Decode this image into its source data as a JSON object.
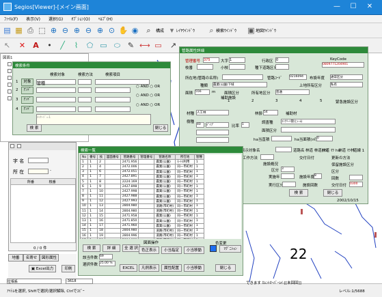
{
  "window": {
    "title": "Segios[Viewer]-[メイン画面]",
    "min": "—",
    "max": "☐",
    "close": "✕"
  },
  "menu": [
    "ﾌｧｲﾙ(F)",
    "表示(V)",
    "選択(G)",
    "ｵﾌﾟｼｮﾝ(O)",
    "ﾍﾙﾌﾟ(H)"
  ],
  "toolbar": {
    "frame_label": "構成",
    "layer_label": "ﾚｲﾔｳｲﾝﾄﾞｳ",
    "search_label": "検索ｳｲﾝﾄﾞｳ",
    "map_label": "地図ｳｲﾝﾄﾞｳ"
  },
  "tree": {
    "root": "図面1",
    "items": [
      "",
      "",
      "",
      "",
      "",
      "",
      "",
      ""
    ]
  },
  "search_dialog": {
    "title": "検索条件",
    "col_target": "検索対象",
    "col_method": "検索方法",
    "col_value": "検索項目",
    "rows": [
      {
        "no": "1",
        "kind": "対象",
        "field": "管種"
      },
      {
        "no": "2",
        "kind": "ｱﾝﾄﾞ",
        "field": ""
      },
      {
        "no": "3",
        "kind": "ｱﾝﾄﾞ",
        "field": ""
      },
      {
        "no": "4",
        "kind": "ｱﾝﾄﾞ",
        "field": ""
      }
    ],
    "and_label": "AND",
    "or_label": "OR",
    "result_text": "ﾒｯｾｰｼﾞ=1",
    "search_btn": "検 索",
    "close_btn": "閉じる"
  },
  "detail": {
    "title": "管路属性詳細",
    "kanri_label": "管理番号",
    "kanri_value": "375",
    "jiban_label": "大字",
    "jiban_value": "1",
    "chiku_label": "行政区",
    "chiku_value": "0",
    "keycode_label": "KeyCode",
    "keycode_value": "0809771204901",
    "line2_label": "枝番",
    "line2b": "小枝",
    "line2c": "種下道路区分",
    "region_label": "所在地(管路の名称)",
    "region_value": "",
    "pipe_label": "管路ｺｰﾄﾞ",
    "pipe_value": "0216094",
    "owner_label": "布設年度",
    "owner_value": "通常区分",
    "line_label": "種類",
    "line_value": "農業(公園)下域",
    "water_label": "上地所有区分",
    "water_value": "私有",
    "ocean_label": "面積",
    "ocean_value": "556",
    "unit": "m",
    "area_label": "面積区分",
    "area2_label": "所有地区分",
    "area2_value": "普通",
    "field1": "1",
    "field2": "2",
    "field3": "3",
    "field4": "4",
    "field5": "5",
    "sub_label": "補助施設",
    "sub2": "緊急施設区分",
    "mat_label": "材種",
    "mat_value": "人工林",
    "flow_label": "林齢",
    "flow_value": "54",
    "fl_label": "補助材",
    "cls_label": "樹種",
    "cls1": "40",
    "cls1b": "ﾊﾟｲﾌﾟ",
    "ratio_label": "比率",
    "ratio_value": "1",
    "shape_label": "調査種",
    "shape_value": "ｺﾝｸﾘｰﾄ管(ﾋｭｰﾑ)",
    "area3": "面積区分",
    "ha_label": "ha当直積",
    "ha_label2": "ha当面積(㎡)",
    "ha_value": "0",
    "bottom": [
      "表示対象名",
      "道路名",
      "林道 林道(ﾏﾂ)",
      "林道 ﾏﾂ ha",
      "林道 ﾏﾂ林",
      "道線 1"
    ],
    "side_labels": [
      "工作方法",
      "施設概況",
      "区分",
      "実施年",
      "施設年度",
      "交付日付"
    ],
    "side_labels2": [
      "更新の方法",
      "保留施設区分",
      "区分",
      "回数",
      "交付日付"
    ],
    "side_values": [
      "",
      "",
      "3",
      "",
      "8",
      "0300"
    ],
    "exec_label": "実行区分",
    "exec2": "施設回数",
    "exec3": "施設分類",
    "exec4": "補強等",
    "exec5": "実施日",
    "exec6": "07/",
    "exec7": "2024",
    "search_btn": "検 索",
    "close_btn": "閉じる",
    "date": "2002/10/15"
  },
  "list_window": {
    "title": "検索一覧",
    "headers": [
      "No",
      "番号",
      "枝",
      "図面番号",
      "管路番号",
      "管理番号",
      "管路名称",
      "所在地",
      "管種"
    ],
    "rows": [
      [
        "1",
        "1",
        "2",
        "",
        "2471.956",
        "",
        "農業(公園)",
        "ﾓｰﾄﾙ利用",
        "1"
      ],
      [
        "2",
        "1",
        "4",
        "",
        "2472.006",
        "",
        "農業(公園)",
        "同一市町村",
        "1"
      ],
      [
        "3",
        "1",
        "6",
        "",
        "2472.051",
        "",
        "農業(公園)",
        "同一市町村",
        "1"
      ],
      [
        "4",
        "1",
        "7",
        "",
        "2427.891",
        "",
        "農業(公園)",
        "同一市町村",
        "1"
      ],
      [
        "5",
        "1",
        "8",
        "",
        "2224.169",
        "",
        "農業(公園)",
        "同一市町村",
        "1"
      ],
      [
        "6",
        "1",
        "9",
        "",
        "2427.898",
        "",
        "農業(公園)",
        "同一市町村",
        "1"
      ],
      [
        "7",
        "1",
        "10",
        "",
        "2427.998",
        "",
        "農業(公園)",
        "同一市町村",
        "1"
      ],
      [
        "8",
        "1",
        "11",
        "",
        "2427.988",
        "",
        "農業(公園)",
        "同一市町村",
        "1"
      ],
      [
        "9",
        "1",
        "12",
        "",
        "2427.993",
        "",
        "農業(公園)",
        "同一市町村",
        "1"
      ],
      [
        "10",
        "1",
        "13",
        "",
        "2804.980",
        "",
        "道路(市町村)",
        "同一市町村",
        "1"
      ],
      [
        "11",
        "1",
        "14",
        "",
        "2804.980",
        "",
        "道路(市町村)",
        "同一市町村",
        "1"
      ],
      [
        "12",
        "1",
        "15",
        "",
        "2471.958",
        "",
        "農業(公園)",
        "同一市町村",
        "1"
      ],
      [
        "13",
        "1",
        "16",
        "",
        "2471.850",
        "",
        "農業(公園)",
        "同一市町村",
        "1"
      ],
      [
        "14",
        "1",
        "17",
        "",
        "2471.960",
        "",
        "農業(公園)",
        "同一市町村",
        "1"
      ],
      [
        "15",
        "1",
        "18",
        "",
        "2804.980",
        "",
        "道路(市町村)",
        "同一市町村",
        "1"
      ],
      [
        "16",
        "1",
        "19",
        "",
        "2804.996",
        "",
        "道路(市町村)",
        "同一市町村",
        "1"
      ],
      [
        "17",
        "1",
        "20",
        "",
        "2804.980",
        "",
        "道路(市町村)",
        "同一市町村",
        "1"
      ],
      [
        "18",
        "1",
        "21",
        "",
        "2804.966",
        "",
        "道路(市町村)",
        "同一市町村",
        "1"
      ],
      [
        "19",
        "1",
        "22",
        "",
        "2804.966",
        "",
        "道路(市町村)",
        "同一市町村",
        "1"
      ],
      [
        "20",
        "1",
        "23",
        "",
        "2804.980",
        "",
        "道路(市町村)",
        "同一市町村",
        "1"
      ],
      [
        "21",
        "1",
        "24",
        "",
        "2804.980",
        "",
        "道路(市町村)",
        "同一市町村",
        "1"
      ],
      [
        "22",
        "1",
        "25",
        "",
        "2804.958",
        "",
        "道路(市町村)",
        "同一市町村",
        "1"
      ],
      [
        "23",
        "1",
        "26",
        "",
        "2804.958",
        "",
        "道路(市町村)",
        "同一市町村",
        "1"
      ],
      [
        "24",
        "1",
        "27",
        "",
        "2804.958",
        "",
        "道路(市町村)",
        "同一市町村",
        "1"
      ],
      [
        "25",
        "1",
        "28",
        "",
        "2804.958",
        "",
        "道路(市町村)",
        "同一市町村",
        "1"
      ],
      [
        "26",
        "1",
        "29",
        "",
        "2804.958",
        "",
        "道路(市町村)",
        "同一市町村",
        "1"
      ]
    ],
    "btn_search": "検 索",
    "btn_detail": "詳 細",
    "btn_close": "全 選 択",
    "btn_nodisp": "全 選 択",
    "count_label": "該当件数",
    "count_value": "69",
    "cur_label": "選択件数",
    "cur_value": "25.00 %",
    "panel_title": "図面操作",
    "p1": "色正表示",
    "p2": "小当指定",
    "p3": "小当移動",
    "p4": "EXCEL",
    "p5": "凡例表示",
    "p6": "属性配置",
    "p7": "小当移動",
    "color_label": "色変更",
    "color_btn": "ﾏｸﾞﾆｼｮﾝ",
    "close2": "閉じる"
  },
  "left_panel": {
    "pref_label": "字 名",
    "area_label": "所 在",
    "hyphen": "-",
    "h1": "所番",
    "h2": "枝番",
    "count": "0 / 0 件",
    "tab1": "地番",
    "tab2": "名寄せ",
    "tab3": "図形属性",
    "excel_btn": "Excel出力",
    "print_btn": "印刷"
  },
  "map_number": "22",
  "status": {
    "field1": "位相系",
    "field2": "-3618",
    "msg": "ｱｲﾃﾑを選択, Shiftで選択/選択解除, Ctrlでｺﾋﾟｰ",
    "right_msg": "できます ｶﾚﾝﾄｵｰﾊﾞｰﾚｲ:[[未回回]]",
    "right_val": "レベル:1/5688"
  }
}
